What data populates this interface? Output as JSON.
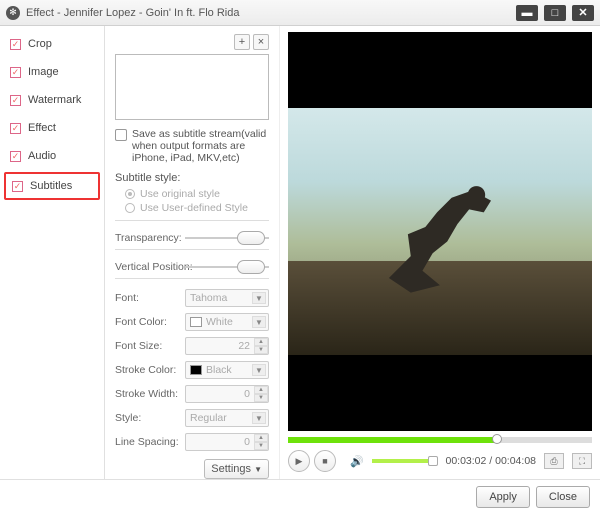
{
  "window": {
    "title": "Effect - Jennifer Lopez - Goin' In ft. Flo Rida"
  },
  "sidebar": {
    "items": [
      {
        "label": "Crop"
      },
      {
        "label": "Image"
      },
      {
        "label": "Watermark"
      },
      {
        "label": "Effect"
      },
      {
        "label": "Audio"
      },
      {
        "label": "Subtitles"
      }
    ]
  },
  "subtitles": {
    "save_stream": "Save as subtitle stream(valid when output formats are iPhone, iPad, MKV,etc)",
    "style_label": "Subtitle style:",
    "radio_orig": "Use original style",
    "radio_user": "Use User-defined Style",
    "transparency_label": "Transparency:",
    "vposition_label": "Vertical Position:",
    "font_label": "Font:",
    "font_value": "Tahoma",
    "fontcolor_label": "Font Color:",
    "fontcolor_value": "White",
    "fontcolor_hex": "#ffffff",
    "fontsize_label": "Font Size:",
    "fontsize_value": "22",
    "strokecolor_label": "Stroke Color:",
    "strokecolor_value": "Black",
    "strokecolor_hex": "#000000",
    "strokewidth_label": "Stroke Width:",
    "strokewidth_value": "0",
    "style2_label": "Style:",
    "style2_value": "Regular",
    "linespacing_label": "Line Spacing:",
    "linespacing_value": "0",
    "settings_btn": "Settings"
  },
  "player": {
    "elapsed": "00:03:02",
    "total": "00:04:08",
    "sep": " / "
  },
  "footer": {
    "apply": "Apply",
    "close": "Close"
  }
}
